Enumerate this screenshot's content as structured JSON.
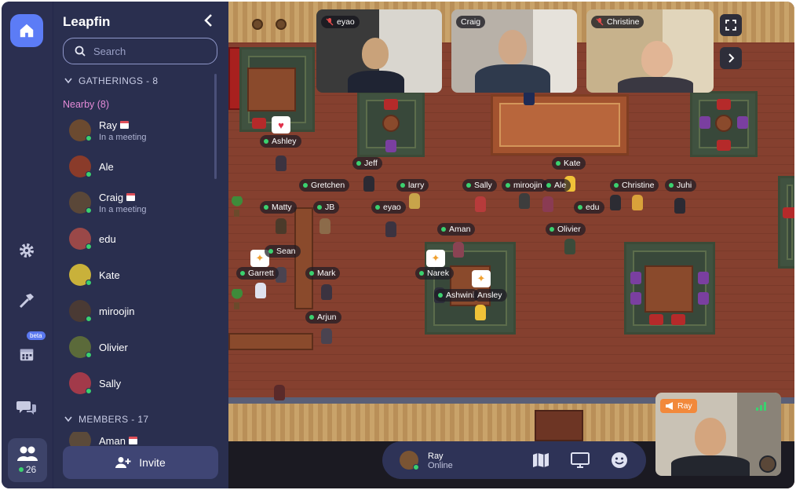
{
  "sidebar": {
    "title": "Leapfin",
    "search_placeholder": "Search",
    "gatherings_label": "GATHERINGS - 8",
    "nearby_label": "Nearby (8)",
    "members_label": "MEMBERS - 17",
    "invite_label": "Invite",
    "people": [
      {
        "name": "Ray",
        "sub": "In a meeting",
        "calendar": true
      },
      {
        "name": "Ale",
        "sub": "",
        "calendar": false
      },
      {
        "name": "Craig",
        "sub": "In a meeting",
        "calendar": true
      },
      {
        "name": "edu",
        "sub": "",
        "calendar": false
      },
      {
        "name": "Kate",
        "sub": "",
        "calendar": false
      },
      {
        "name": "miroojin",
        "sub": "",
        "calendar": false
      },
      {
        "name": "Olivier",
        "sub": "",
        "calendar": false
      },
      {
        "name": "Sally",
        "sub": "",
        "calendar": false
      }
    ],
    "members": [
      {
        "name": "Aman",
        "calendar": true
      }
    ]
  },
  "rail": {
    "online_count": "26",
    "beta_label": "beta"
  },
  "video": {
    "tiles": [
      {
        "name": "eyao",
        "muted": true
      },
      {
        "name": "Craig",
        "muted": false
      },
      {
        "name": "Christine",
        "muted": true
      }
    ],
    "self_name": "Ray"
  },
  "map": {
    "name_tags": [
      {
        "name": "Ashley"
      },
      {
        "name": "Jeff"
      },
      {
        "name": "Kate"
      },
      {
        "name": "Gretchen"
      },
      {
        "name": "larry"
      },
      {
        "name": "Sally"
      },
      {
        "name": "miroojin"
      },
      {
        "name": "Ale"
      },
      {
        "name": "Christine"
      },
      {
        "name": "Juhi"
      },
      {
        "name": "Matty"
      },
      {
        "name": "JB"
      },
      {
        "name": "eyao"
      },
      {
        "name": "edu"
      },
      {
        "name": "Aman"
      },
      {
        "name": "Olivier"
      },
      {
        "name": "Sean"
      },
      {
        "name": "Garrett"
      },
      {
        "name": "Mark"
      },
      {
        "name": "Narek"
      },
      {
        "name": "Ashwini"
      },
      {
        "name": "Ansley"
      },
      {
        "name": "Arjun"
      }
    ]
  },
  "bottom_bar": {
    "user_name": "Ray",
    "user_status": "Online"
  },
  "colors": {
    "accent": "#5c7cf6",
    "online": "#3bd16f",
    "nearby": "#e48ad7",
    "self_label": "#f2893b"
  }
}
